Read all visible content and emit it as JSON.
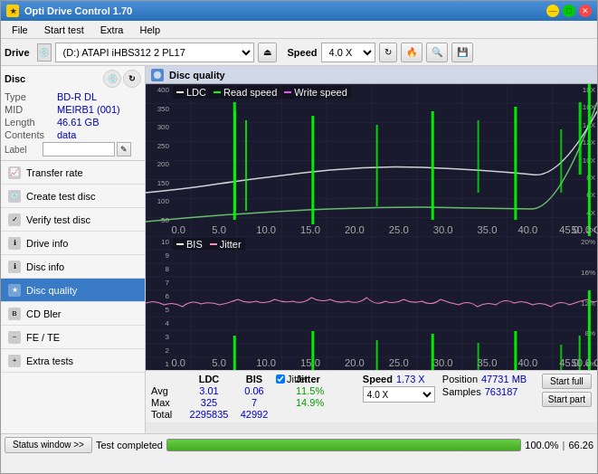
{
  "app": {
    "title": "Opti Drive Control 1.70",
    "icon": "★"
  },
  "title_controls": {
    "minimize": "—",
    "maximize": "□",
    "close": "✕"
  },
  "menu": {
    "items": [
      "File",
      "Start test",
      "Extra",
      "Help"
    ]
  },
  "toolbar": {
    "drive_label": "Drive",
    "drive_value": "(D:) ATAPI iHBS312  2 PL17",
    "speed_label": "Speed",
    "speed_value": "4.0 X"
  },
  "disc": {
    "section_label": "Disc",
    "type_label": "Type",
    "type_value": "BD-R DL",
    "mid_label": "MID",
    "mid_value": "MEIRB1 (001)",
    "length_label": "Length",
    "length_value": "46.61 GB",
    "contents_label": "Contents",
    "contents_value": "data",
    "label_label": "Label",
    "label_value": ""
  },
  "nav": {
    "items": [
      {
        "id": "transfer-rate",
        "label": "Transfer rate",
        "active": false
      },
      {
        "id": "create-test-disc",
        "label": "Create test disc",
        "active": false
      },
      {
        "id": "verify-test-disc",
        "label": "Verify test disc",
        "active": false
      },
      {
        "id": "drive-info",
        "label": "Drive info",
        "active": false
      },
      {
        "id": "disc-info",
        "label": "Disc info",
        "active": false
      },
      {
        "id": "disc-quality",
        "label": "Disc quality",
        "active": true
      },
      {
        "id": "cd-bler",
        "label": "CD Bler",
        "active": false
      },
      {
        "id": "fe-te",
        "label": "FE / TE",
        "active": false
      },
      {
        "id": "extra-tests",
        "label": "Extra tests",
        "active": false
      }
    ]
  },
  "disc_quality": {
    "title": "Disc quality",
    "legend": {
      "ldc": "LDC",
      "read": "Read speed",
      "write": "Write speed",
      "bis": "BIS",
      "jitter": "Jitter"
    },
    "chart1": {
      "y_right_labels": [
        "18X",
        "16X",
        "14X",
        "12X",
        "10X",
        "8X",
        "6X",
        "4X",
        "2X"
      ],
      "y_left_labels": [
        "400",
        "350",
        "300",
        "250",
        "200",
        "150",
        "100",
        "50",
        ""
      ],
      "x_labels": [
        "0.0",
        "5.0",
        "10.0",
        "15.0",
        "20.0",
        "25.0",
        "30.0",
        "35.0",
        "40.0",
        "45.0",
        "50.0 GB"
      ]
    },
    "chart2": {
      "title_labels": [
        "BIS",
        "Jitter"
      ],
      "y_right_labels": [
        "20%",
        "16%",
        "12%",
        "8%",
        "4%"
      ],
      "y_left_labels": [
        "10",
        "9",
        "8",
        "7",
        "6",
        "5",
        "4",
        "3",
        "2",
        "1"
      ],
      "x_labels": [
        "0.0",
        "5.0",
        "10.0",
        "15.0",
        "20.0",
        "25.0",
        "30.0",
        "35.0",
        "40.0",
        "45.0",
        "50.0 GB"
      ]
    },
    "stats": {
      "columns": [
        "",
        "LDC",
        "BIS",
        "",
        "Jitter",
        "Speed"
      ],
      "rows": [
        {
          "label": "Avg",
          "ldc": "3.01",
          "bis": "0.06",
          "jitter": "11.5%",
          "speed_label": "1.73 X"
        },
        {
          "label": "Max",
          "ldc": "325",
          "bis": "7",
          "jitter": "14.9%",
          "speed_value": "4.0 X"
        },
        {
          "label": "Total",
          "ldc": "2295835",
          "bis": "42992",
          "jitter": ""
        }
      ],
      "jitter_checked": true,
      "position_label": "Position",
      "position_value": "47731 MB",
      "samples_label": "Samples",
      "samples_value": "763187"
    },
    "buttons": {
      "start_full": "Start full",
      "start_part": "Start part"
    }
  },
  "status_bar": {
    "window_btn": "Status window >>",
    "status_text": "Test completed",
    "progress_pct": 100,
    "progress_display": "100.0%",
    "extra_value": "66.26"
  }
}
